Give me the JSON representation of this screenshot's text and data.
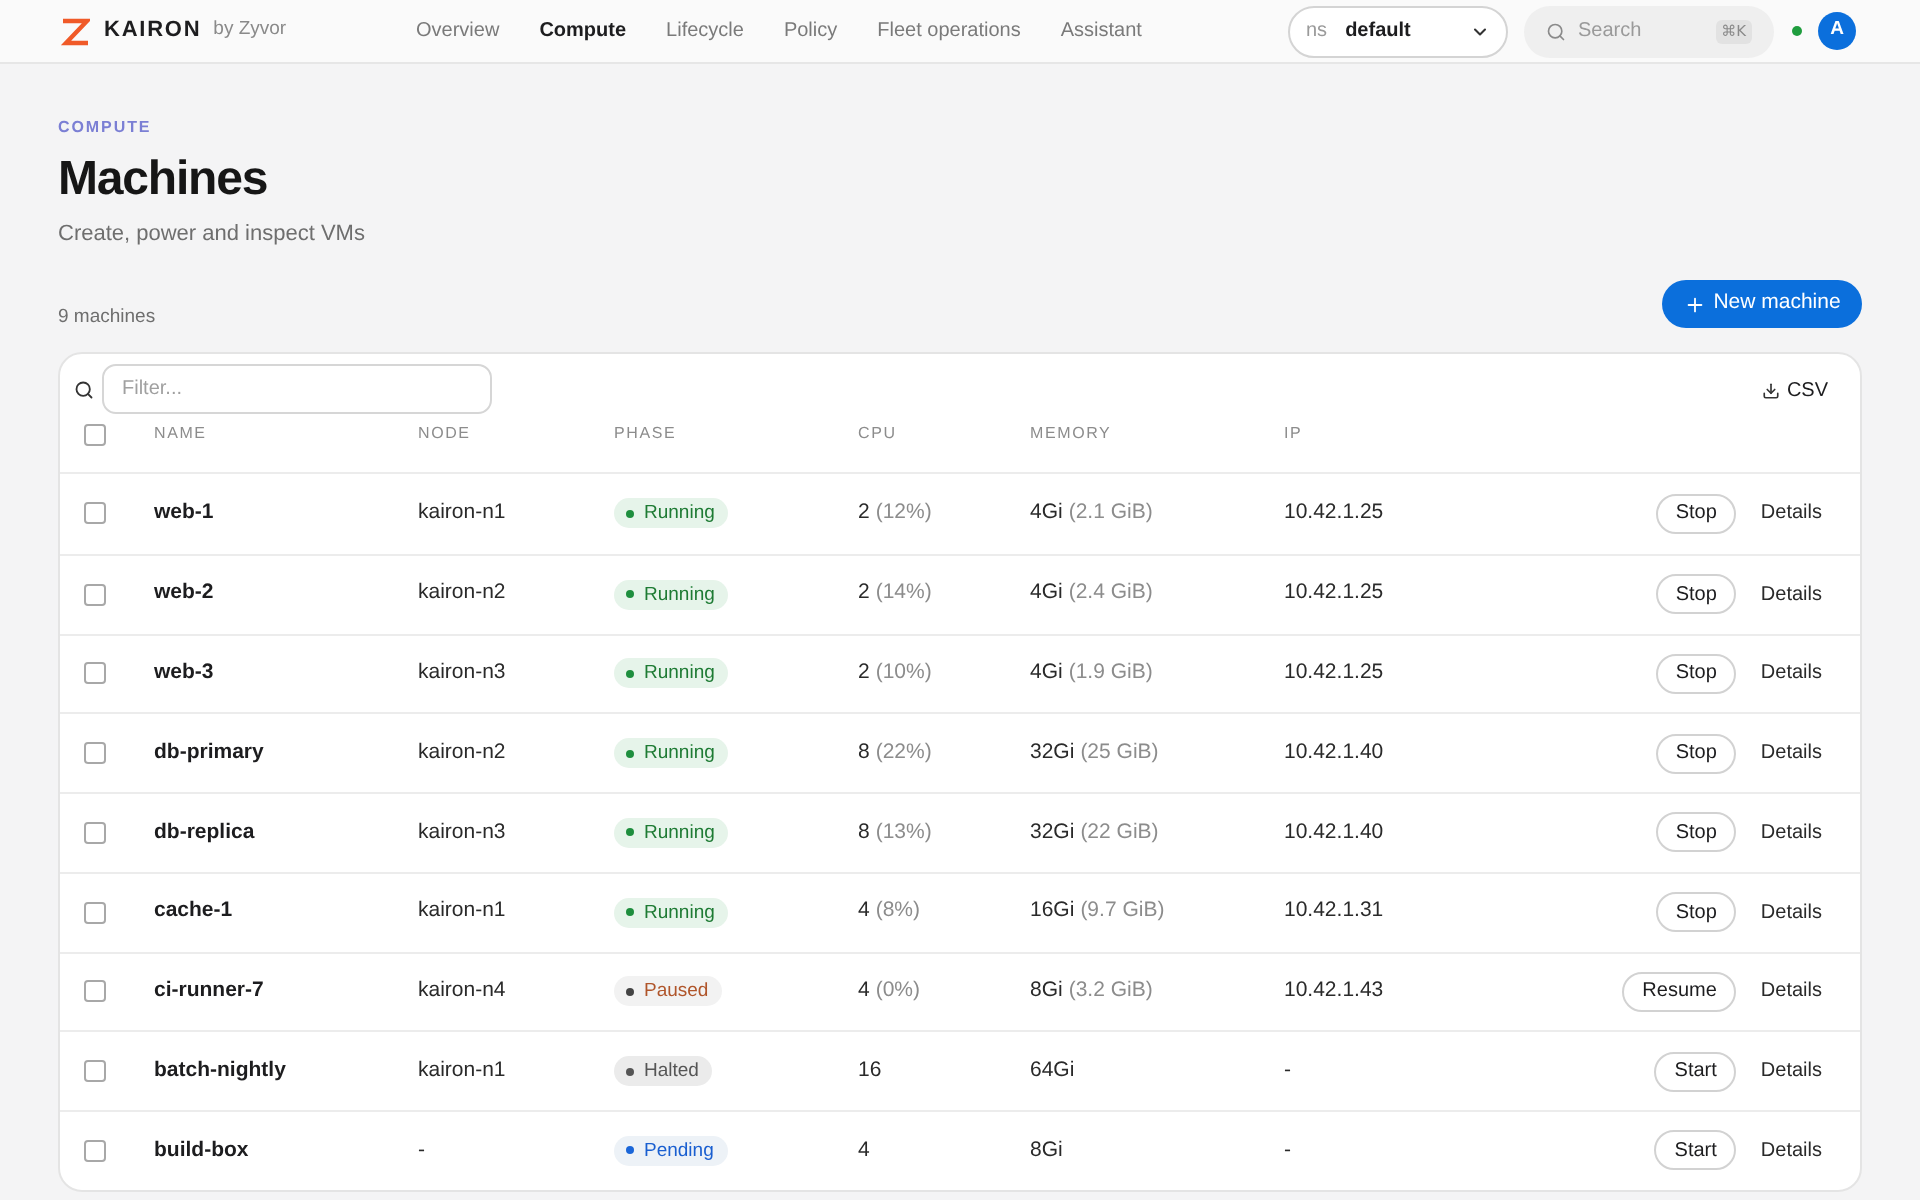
{
  "topbar": {
    "brand": "KAIRON",
    "brand_by": "by Zyvor",
    "nav": [
      {
        "label": "Overview",
        "selected": false
      },
      {
        "label": "Compute",
        "selected": true
      },
      {
        "label": "Lifecycle",
        "selected": false
      },
      {
        "label": "Policy",
        "selected": false
      },
      {
        "label": "Fleet operations",
        "selected": false
      },
      {
        "label": "Assistant",
        "selected": false
      }
    ],
    "namespace": {
      "prefix": "ns",
      "value": "default"
    },
    "search": {
      "placeholder": "Search",
      "shortcut": "⌘K"
    },
    "online": true,
    "avatar": "A"
  },
  "page": {
    "section": "COMPUTE",
    "title": "Machines",
    "subtitle": "Create, power and inspect VMs",
    "count": "9 machines",
    "new_button": "New machine"
  },
  "table": {
    "filter": {
      "placeholder": "Filter..."
    },
    "export": "CSV",
    "header_checked": false,
    "columns": [
      "NAME",
      "NODE",
      "PHASE",
      "CPU",
      "MEMORY",
      "IP"
    ],
    "rows": [
      {
        "checked": false,
        "name": "web-1",
        "node": "kairon-n1",
        "phase": {
          "label": "Running",
          "kind": "running"
        },
        "cpu": "2",
        "cpu_usage": "(12%)",
        "memory": "4Gi",
        "memory_usage": "(2.1 GiB)",
        "ip": "10.42.1.25",
        "action": "Stop",
        "details": "Details"
      },
      {
        "checked": false,
        "name": "web-2",
        "node": "kairon-n2",
        "phase": {
          "label": "Running",
          "kind": "running"
        },
        "cpu": "2",
        "cpu_usage": "(14%)",
        "memory": "4Gi",
        "memory_usage": "(2.4 GiB)",
        "ip": "10.42.1.25",
        "action": "Stop",
        "details": "Details"
      },
      {
        "checked": false,
        "name": "web-3",
        "node": "kairon-n3",
        "phase": {
          "label": "Running",
          "kind": "running"
        },
        "cpu": "2",
        "cpu_usage": "(10%)",
        "memory": "4Gi",
        "memory_usage": "(1.9 GiB)",
        "ip": "10.42.1.25",
        "action": "Stop",
        "details": "Details"
      },
      {
        "checked": false,
        "name": "db-primary",
        "node": "kairon-n2",
        "phase": {
          "label": "Running",
          "kind": "running"
        },
        "cpu": "8",
        "cpu_usage": "(22%)",
        "memory": "32Gi",
        "memory_usage": "(25 GiB)",
        "ip": "10.42.1.40",
        "action": "Stop",
        "details": "Details"
      },
      {
        "checked": false,
        "name": "db-replica",
        "node": "kairon-n3",
        "phase": {
          "label": "Running",
          "kind": "running"
        },
        "cpu": "8",
        "cpu_usage": "(13%)",
        "memory": "32Gi",
        "memory_usage": "(22 GiB)",
        "ip": "10.42.1.40",
        "action": "Stop",
        "details": "Details"
      },
      {
        "checked": false,
        "name": "cache-1",
        "node": "kairon-n1",
        "phase": {
          "label": "Running",
          "kind": "running"
        },
        "cpu": "4",
        "cpu_usage": "(8%)",
        "memory": "16Gi",
        "memory_usage": "(9.7 GiB)",
        "ip": "10.42.1.31",
        "action": "Stop",
        "details": "Details"
      },
      {
        "checked": false,
        "name": "ci-runner-7",
        "node": "kairon-n4",
        "phase": {
          "label": "Paused",
          "kind": "paused"
        },
        "cpu": "4",
        "cpu_usage": "(0%)",
        "memory": "8Gi",
        "memory_usage": "(3.2 GiB)",
        "ip": "10.42.1.43",
        "action": "Resume",
        "details": "Details"
      },
      {
        "checked": false,
        "name": "batch-nightly",
        "node": "kairon-n1",
        "phase": {
          "label": "Halted",
          "kind": "halted"
        },
        "cpu": "16",
        "memory": "64Gi",
        "ip": "-",
        "action": "Start",
        "details": "Details"
      },
      {
        "checked": false,
        "name": "build-box",
        "node": "-",
        "phase": {
          "label": "Pending",
          "kind": "pending"
        },
        "cpu": "4",
        "memory": "8Gi",
        "ip": "-",
        "action": "Start",
        "details": "Details"
      }
    ]
  }
}
